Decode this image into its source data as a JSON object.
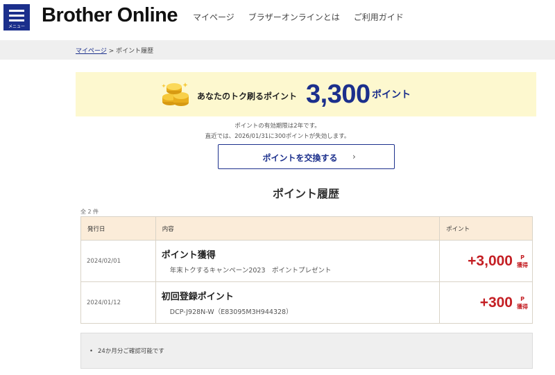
{
  "header": {
    "menu_label": "メニュー",
    "logo": "Brother Online",
    "nav": [
      "マイページ",
      "ブラザーオンラインとは",
      "ご利用ガイド"
    ]
  },
  "breadcrumb": {
    "home": "マイページ",
    "separator": ">",
    "current": "ポイント履歴"
  },
  "banner": {
    "label": "あなたのトク刷るポイント",
    "value": "3,300",
    "unit": "ポイント"
  },
  "notes": {
    "validity": "ポイントの有効期限は2年です。",
    "expiry": "直近では、2026/01/31に300ポイントが失効します。"
  },
  "exchange_button": {
    "label": "ポイントを交換する",
    "chevron": "›"
  },
  "history": {
    "title": "ポイント履歴",
    "count": "全 2 件",
    "columns": [
      "発行日",
      "内容",
      "ポイント"
    ],
    "rows": [
      {
        "date": "2024/02/01",
        "title": "ポイント獲得",
        "subtitle": "年末トクするキャンペーン2023　ポイントプレゼント",
        "points": "+3,000",
        "unit_top": "P",
        "unit_bottom": "獲得"
      },
      {
        "date": "2024/01/12",
        "title": "初回登録ポイント",
        "subtitle": "DCP-J928N-W（E83095M3H944328）",
        "points": "+300",
        "unit_top": "P",
        "unit_bottom": "獲得"
      }
    ]
  },
  "notice": {
    "items": [
      "24か月分ご確認可能です"
    ]
  },
  "colors": {
    "brand_blue": "#1b2f8c",
    "banner_yellow": "#fdf8cf",
    "points_red": "#c41f24",
    "table_header": "#fbecd9"
  }
}
